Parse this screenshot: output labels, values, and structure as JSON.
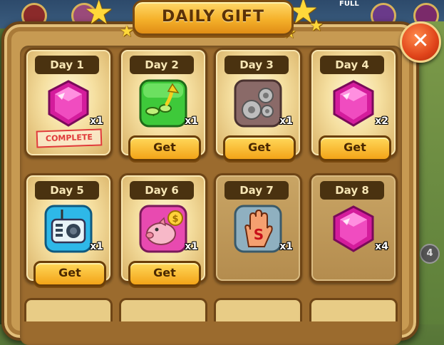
{
  "header": {
    "title": "DAILY GIFT",
    "close_symbol": "✕"
  },
  "background": {
    "status_text": "FULL",
    "badge_number": "4"
  },
  "colors": {
    "accent": "#f5b12a",
    "panel": "#c79a52",
    "close": "#e0441a",
    "stamp": "#e03a3a"
  },
  "days": [
    {
      "label": "Day 1",
      "icon": "pink-gem-icon",
      "quantity": "x1",
      "status": "COMPLETE"
    },
    {
      "label": "Day 2",
      "icon": "plant-growth-icon",
      "quantity": "x1",
      "button": "Get"
    },
    {
      "label": "Day 3",
      "icon": "gears-icon",
      "quantity": "x1",
      "button": "Get"
    },
    {
      "label": "Day 4",
      "icon": "pink-gem-icon",
      "quantity": "x2",
      "button": "Get"
    },
    {
      "label": "Day 5",
      "icon": "radio-icon",
      "quantity": "x1",
      "button": "Get"
    },
    {
      "label": "Day 6",
      "icon": "piggy-bank-icon",
      "quantity": "x1",
      "button": "Get"
    },
    {
      "label": "Day 7",
      "icon": "hand-glove-icon",
      "quantity": "x1"
    },
    {
      "label": "Day 8",
      "icon": "pink-gem-icon",
      "quantity": "x4"
    }
  ]
}
